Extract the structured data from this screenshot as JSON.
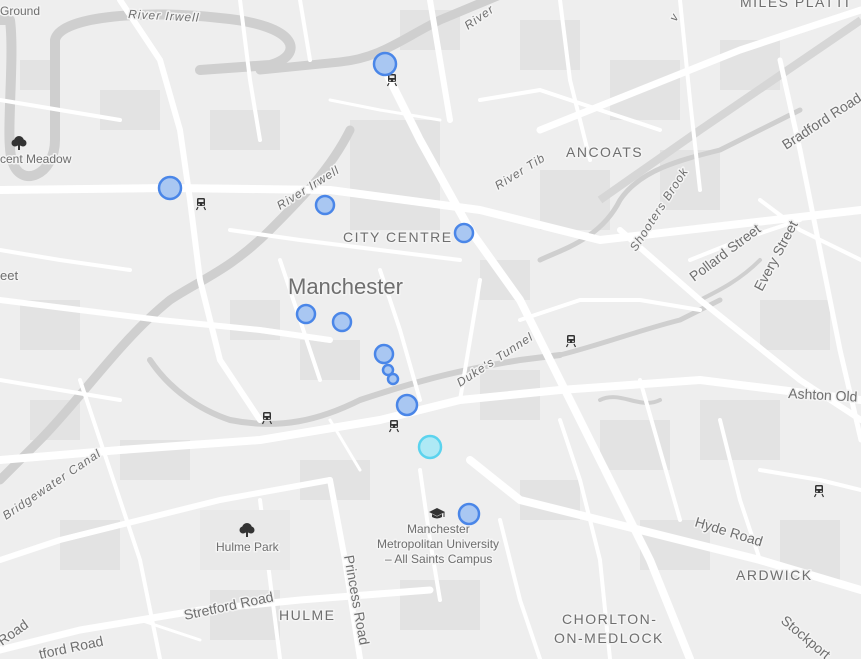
{
  "map": {
    "labels": {
      "city": "Manchester",
      "city_centre": "CITY CENTRE",
      "ancoats": "ANCOATS",
      "ardwick": "ARDWICK",
      "hulme": "HULME",
      "chorlton_1": "CHORLTON-",
      "chorlton_2": "ON-MEDLOCK",
      "miles_platting": "MILES PLATTI",
      "river_irwell_top": "River Irwell",
      "river_irwell_mid": "River Irwell",
      "river_irwell_right": "River",
      "river_tib": "River Tib",
      "shooters_brook": "Shooters Brook",
      "dukes_tunnel": "Duke's Tunnel",
      "bridgewater_canal": "Bridgewater Canal",
      "bradford_road": "Bradford Road",
      "pollard_street": "Pollard Street",
      "every_street": "Every Street",
      "ashton_old": "Ashton Old",
      "hyde_road": "Hyde Road",
      "stretford_road_1": "Stretford Road",
      "stretford_road_2": "tford Road",
      "princess_road": "Princess Road",
      "road_left": "Road",
      "ground": "Ground",
      "crescent_meadow": "cent Meadow",
      "hulme_park": "Hulme Park",
      "mmu_1": "Manchester",
      "mmu_2": "Metropolitan University",
      "mmu_3": "– All Saints Campus",
      "eet": "eet",
      "right_v": "v"
    },
    "icons": {
      "park": "tree-icon",
      "station": "train-icon",
      "university": "graduation-cap-icon"
    },
    "colors": {
      "background": "#eeeeee",
      "road": "#ffffff",
      "water": "#c9c9c9",
      "building": "#e2e2e2",
      "marker_fill": "#a9c7f2",
      "marker_stroke": "#4a86e8",
      "marker_selected_fill": "#aee9f5",
      "marker_selected_stroke": "#5bd3ee",
      "label": "#6f6f6f"
    },
    "markers": [
      {
        "id": "marker-1",
        "selected": false
      },
      {
        "id": "marker-2",
        "selected": false
      },
      {
        "id": "marker-3",
        "selected": false
      },
      {
        "id": "marker-4",
        "selected": false
      },
      {
        "id": "marker-5",
        "selected": false
      },
      {
        "id": "marker-6",
        "selected": false
      },
      {
        "id": "marker-7",
        "selected": false
      },
      {
        "id": "marker-8",
        "selected": false
      },
      {
        "id": "marker-9",
        "selected": false
      },
      {
        "id": "marker-10",
        "selected": false
      },
      {
        "id": "marker-11",
        "selected": false
      },
      {
        "id": "marker-12",
        "selected": true
      },
      {
        "id": "marker-13",
        "selected": false
      }
    ]
  }
}
